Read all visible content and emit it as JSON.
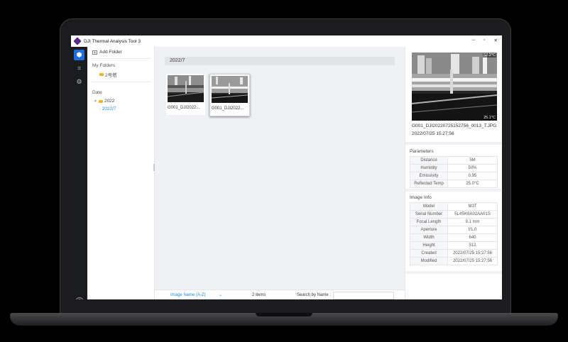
{
  "window": {
    "title": "DJI Thermal Analysis Tool 3",
    "controls": [
      "─",
      "▫",
      "✕"
    ]
  },
  "rail": {
    "items": [
      "library",
      "edit",
      "settings"
    ],
    "help": "?"
  },
  "sidebar": {
    "add_folder": "Add Folder",
    "my_folders_label": "My Folders",
    "my_folders": [
      "2号塔"
    ],
    "date_label": "Date",
    "date_tree": {
      "year": "2022",
      "month": "2022/7"
    }
  },
  "main": {
    "group_title": "2022/7",
    "thumbnails": [
      {
        "caption": "G001_DJI2022...",
        "selected": false
      },
      {
        "caption": "G001_DJI2022...",
        "selected": true
      }
    ],
    "bottom": {
      "sort": "Image Name (A-Z)",
      "count": "2 items",
      "search_label": "Search by Name :",
      "search_value": ""
    }
  },
  "preview": {
    "max_temp": "52.2°C",
    "min_temp": "25.1°C",
    "filename": "G001_DJI20220725152756_0013_T.JPG",
    "datetime": "2022/07/25 15:27:56"
  },
  "parameters": {
    "title": "Parameters",
    "rows": [
      {
        "key": "Distance",
        "value": "5M"
      },
      {
        "key": "Humidity",
        "value": "50%"
      },
      {
        "key": "Emissivity",
        "value": "0.95"
      },
      {
        "key": "Reflected Temp",
        "value": "25.0°C"
      }
    ]
  },
  "image_info": {
    "title": "Image Info",
    "rows": [
      {
        "key": "Model",
        "value": "M3T"
      },
      {
        "key": "Serial Number",
        "value": "5L4SK6A02AA01S"
      },
      {
        "key": "Focal Length",
        "value": "9.1 mm"
      },
      {
        "key": "Aperture",
        "value": "f/1.0"
      },
      {
        "key": "Width",
        "value": "640"
      },
      {
        "key": "Height",
        "value": "512"
      },
      {
        "key": "Created",
        "value": "2022/07/25 15:27:56"
      },
      {
        "key": "Modified",
        "value": "2022/07/25 15:27:56"
      }
    ]
  },
  "colors": {
    "accent": "#1e88e5",
    "rail": "#1b1c20",
    "logo": "#5b2a8a"
  }
}
